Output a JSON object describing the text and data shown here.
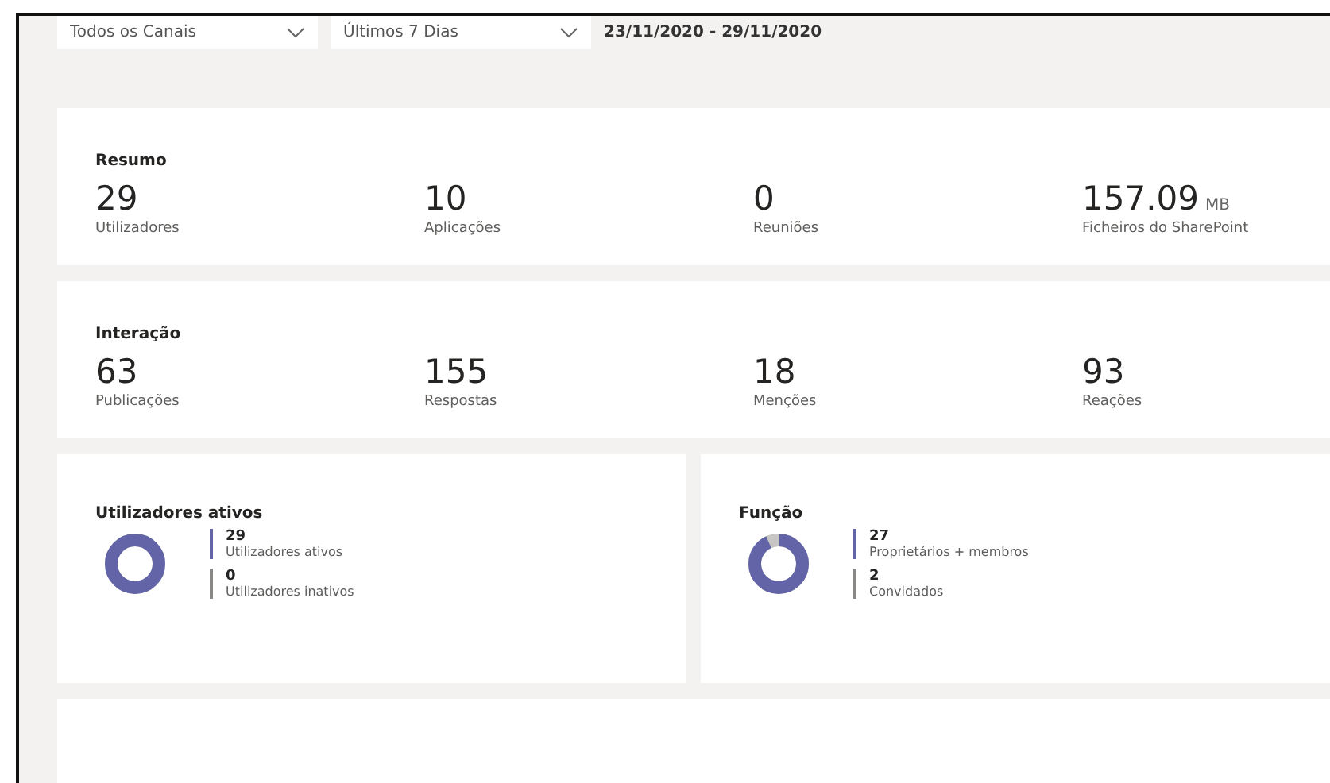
{
  "filters": [
    {
      "label": "Todos os Canais"
    },
    {
      "label": "Últimos 7 Dias"
    }
  ],
  "date_range": "23/11/2020 - 29/11/2020",
  "summary": {
    "title": "Resumo",
    "metrics": [
      {
        "value": "29",
        "label": "Utilizadores"
      },
      {
        "value": "10",
        "label": "Aplicações"
      },
      {
        "value": "0",
        "label": "Reuniões"
      },
      {
        "value": "157.09",
        "unit": "MB",
        "label": "Ficheiros do SharePoint"
      }
    ]
  },
  "interaction": {
    "title": "Interação",
    "metrics": [
      {
        "value": "63",
        "label": "Publicações"
      },
      {
        "value": "155",
        "label": "Respostas"
      },
      {
        "value": "18",
        "label": "Menções"
      },
      {
        "value": "93",
        "label": "Reações"
      }
    ]
  },
  "breakdowns": [
    {
      "title": "Utilizadores ativos",
      "items": [
        {
          "value": "29",
          "label": "Utilizadores ativos",
          "color": "#6264a7"
        },
        {
          "value": "0",
          "label": "Utilizadores inativos",
          "color": "#8a8886"
        }
      ]
    },
    {
      "title": "Função",
      "items": [
        {
          "value": "27",
          "label": "Proprietários + membros",
          "color": "#6264a7"
        },
        {
          "value": "2",
          "label": "Convidados",
          "color": "#8a8886"
        }
      ]
    }
  ]
}
